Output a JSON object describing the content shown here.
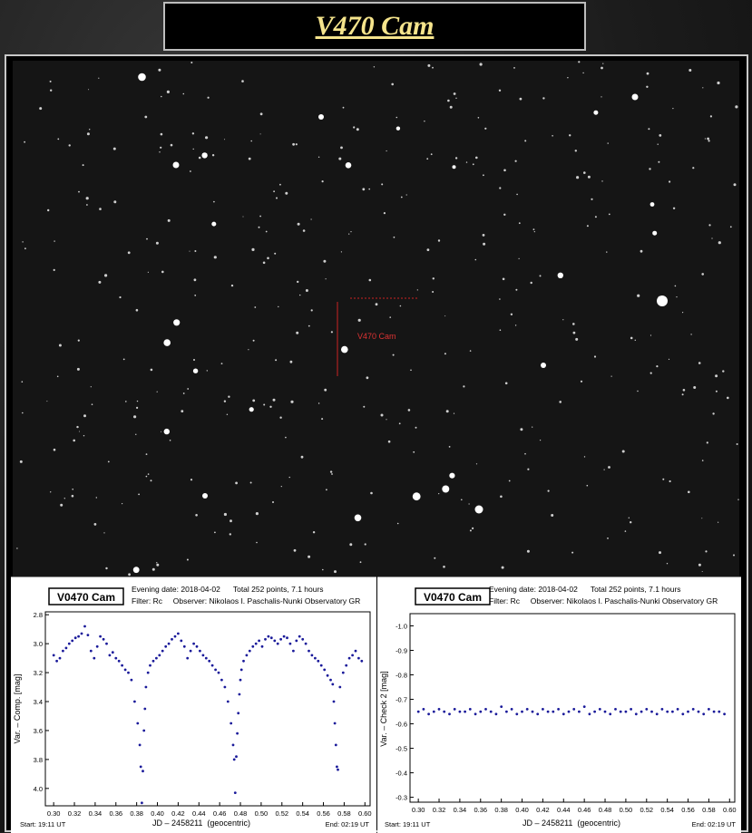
{
  "page": {
    "title": "V470 Cam"
  },
  "finder": {
    "target_label": "V470 Cam"
  },
  "colors": {
    "title": "#f5e48c",
    "marker": "#cc2222",
    "points": "#1a1a9a"
  },
  "chart_data": [
    {
      "type": "scatter",
      "object_label": "V0470 Cam",
      "info_line1": "Evening date: 2018-04-02      Total 252 points, 7.1 hours",
      "info_line2": "Filter: Rc     Observer: Nikolaos I. Paschalis-Nunki Observatory GR",
      "xlabel": "JD – 2458211  (geocentric)",
      "ylabel": "Var. – Comp. [mag]",
      "start_label": "Start: 19:11 UT",
      "end_label": "End: 02:19 UT",
      "xlim": [
        0.292,
        0.605
      ],
      "ylim": [
        2.78,
        4.12
      ],
      "y_inverted": true,
      "xticks": [
        "0.30",
        "0.32",
        "0.34",
        "0.36",
        "0.38",
        "0.40",
        "0.42",
        "0.44",
        "0.46",
        "0.48",
        "0.50",
        "0.52",
        "0.54",
        "0.56",
        "0.58",
        "0.60"
      ],
      "yticks": [
        "2.8",
        "3.0",
        "3.2",
        "3.4",
        "3.6",
        "3.8",
        "4.0"
      ],
      "x": [
        0.3,
        0.303,
        0.306,
        0.309,
        0.312,
        0.315,
        0.318,
        0.321,
        0.324,
        0.327,
        0.33,
        0.333,
        0.336,
        0.339,
        0.342,
        0.345,
        0.348,
        0.351,
        0.354,
        0.357,
        0.36,
        0.363,
        0.366,
        0.369,
        0.372,
        0.375,
        0.378,
        0.381,
        0.383,
        0.384,
        0.385,
        0.386,
        0.387,
        0.388,
        0.389,
        0.391,
        0.393,
        0.396,
        0.399,
        0.402,
        0.405,
        0.408,
        0.411,
        0.414,
        0.417,
        0.42,
        0.423,
        0.426,
        0.429,
        0.432,
        0.435,
        0.438,
        0.441,
        0.444,
        0.447,
        0.45,
        0.453,
        0.456,
        0.459,
        0.462,
        0.465,
        0.468,
        0.471,
        0.473,
        0.474,
        0.475,
        0.476,
        0.477,
        0.478,
        0.479,
        0.48,
        0.481,
        0.483,
        0.486,
        0.489,
        0.492,
        0.495,
        0.498,
        0.501,
        0.504,
        0.507,
        0.51,
        0.513,
        0.516,
        0.519,
        0.522,
        0.525,
        0.528,
        0.531,
        0.534,
        0.537,
        0.54,
        0.543,
        0.546,
        0.549,
        0.552,
        0.555,
        0.558,
        0.561,
        0.564,
        0.567,
        0.569,
        0.57,
        0.571,
        0.572,
        0.573,
        0.574,
        0.576,
        0.579,
        0.582,
        0.585,
        0.588,
        0.591,
        0.594,
        0.597
      ],
      "y": [
        3.08,
        3.12,
        3.1,
        3.05,
        3.03,
        3.0,
        2.98,
        2.96,
        2.95,
        2.93,
        2.88,
        2.94,
        3.05,
        3.1,
        3.02,
        2.95,
        2.97,
        3.0,
        3.08,
        3.06,
        3.1,
        3.12,
        3.15,
        3.18,
        3.2,
        3.25,
        3.4,
        3.55,
        3.7,
        3.85,
        4.1,
        3.88,
        3.6,
        3.45,
        3.3,
        3.2,
        3.15,
        3.12,
        3.1,
        3.08,
        3.05,
        3.02,
        3.0,
        2.97,
        2.95,
        2.93,
        2.98,
        3.02,
        3.1,
        3.05,
        3.0,
        3.02,
        3.05,
        3.08,
        3.1,
        3.12,
        3.15,
        3.18,
        3.2,
        3.25,
        3.3,
        3.4,
        3.55,
        3.7,
        3.8,
        4.03,
        3.78,
        3.62,
        3.48,
        3.35,
        3.25,
        3.18,
        3.12,
        3.08,
        3.05,
        3.02,
        3.0,
        2.98,
        3.02,
        2.97,
        2.95,
        2.96,
        2.98,
        3.0,
        2.97,
        2.95,
        2.96,
        3.0,
        3.05,
        2.98,
        2.95,
        2.97,
        3.0,
        3.05,
        3.08,
        3.1,
        3.12,
        3.15,
        3.18,
        3.22,
        3.25,
        3.28,
        3.4,
        3.55,
        3.7,
        3.85,
        3.87,
        3.3,
        3.2,
        3.15,
        3.1,
        3.08,
        3.05,
        3.1,
        3.12
      ]
    },
    {
      "type": "scatter",
      "object_label": "V0470 Cam",
      "info_line1": "Evening date: 2018-04-02      Total 252 points, 7.1 hours",
      "info_line2": "Filter: Rc     Observer: Nikolaos I. Paschalis-Nunki Observatory GR",
      "xlabel": "JD – 2458211  (geocentric)",
      "ylabel": "Var. – Check 2 [mag]",
      "start_label": "Start: 19:11 UT",
      "end_label": "End: 02:19 UT",
      "xlim": [
        0.292,
        0.605
      ],
      "ylim": [
        -1.05,
        -0.28
      ],
      "y_inverted": true,
      "xticks": [
        "0.30",
        "0.32",
        "0.34",
        "0.36",
        "0.38",
        "0.40",
        "0.42",
        "0.44",
        "0.46",
        "0.48",
        "0.50",
        "0.52",
        "0.54",
        "0.56",
        "0.58",
        "0.60"
      ],
      "yticks": [
        "-1.0",
        "-0.9",
        "-0.8",
        "-0.7",
        "-0.6",
        "-0.5",
        "-0.4",
        "-0.3"
      ],
      "x": [
        0.3,
        0.305,
        0.31,
        0.315,
        0.32,
        0.325,
        0.33,
        0.335,
        0.34,
        0.345,
        0.35,
        0.355,
        0.36,
        0.365,
        0.37,
        0.375,
        0.38,
        0.385,
        0.39,
        0.395,
        0.4,
        0.405,
        0.41,
        0.415,
        0.42,
        0.425,
        0.43,
        0.435,
        0.44,
        0.445,
        0.45,
        0.455,
        0.46,
        0.465,
        0.47,
        0.475,
        0.48,
        0.485,
        0.49,
        0.495,
        0.5,
        0.505,
        0.51,
        0.515,
        0.52,
        0.525,
        0.53,
        0.535,
        0.54,
        0.545,
        0.55,
        0.555,
        0.56,
        0.565,
        0.57,
        0.575,
        0.58,
        0.585,
        0.59,
        0.595
      ],
      "y": [
        -0.65,
        -0.66,
        -0.64,
        -0.65,
        -0.66,
        -0.65,
        -0.64,
        -0.66,
        -0.65,
        -0.65,
        -0.66,
        -0.64,
        -0.65,
        -0.66,
        -0.65,
        -0.64,
        -0.67,
        -0.65,
        -0.66,
        -0.64,
        -0.65,
        -0.66,
        -0.65,
        -0.64,
        -0.66,
        -0.65,
        -0.65,
        -0.66,
        -0.64,
        -0.65,
        -0.66,
        -0.65,
        -0.67,
        -0.64,
        -0.65,
        -0.66,
        -0.65,
        -0.64,
        -0.66,
        -0.65,
        -0.65,
        -0.66,
        -0.64,
        -0.65,
        -0.66,
        -0.65,
        -0.64,
        -0.66,
        -0.65,
        -0.65,
        -0.66,
        -0.64,
        -0.65,
        -0.66,
        -0.65,
        -0.64,
        -0.66,
        -0.65,
        -0.65,
        -0.64
      ]
    }
  ]
}
